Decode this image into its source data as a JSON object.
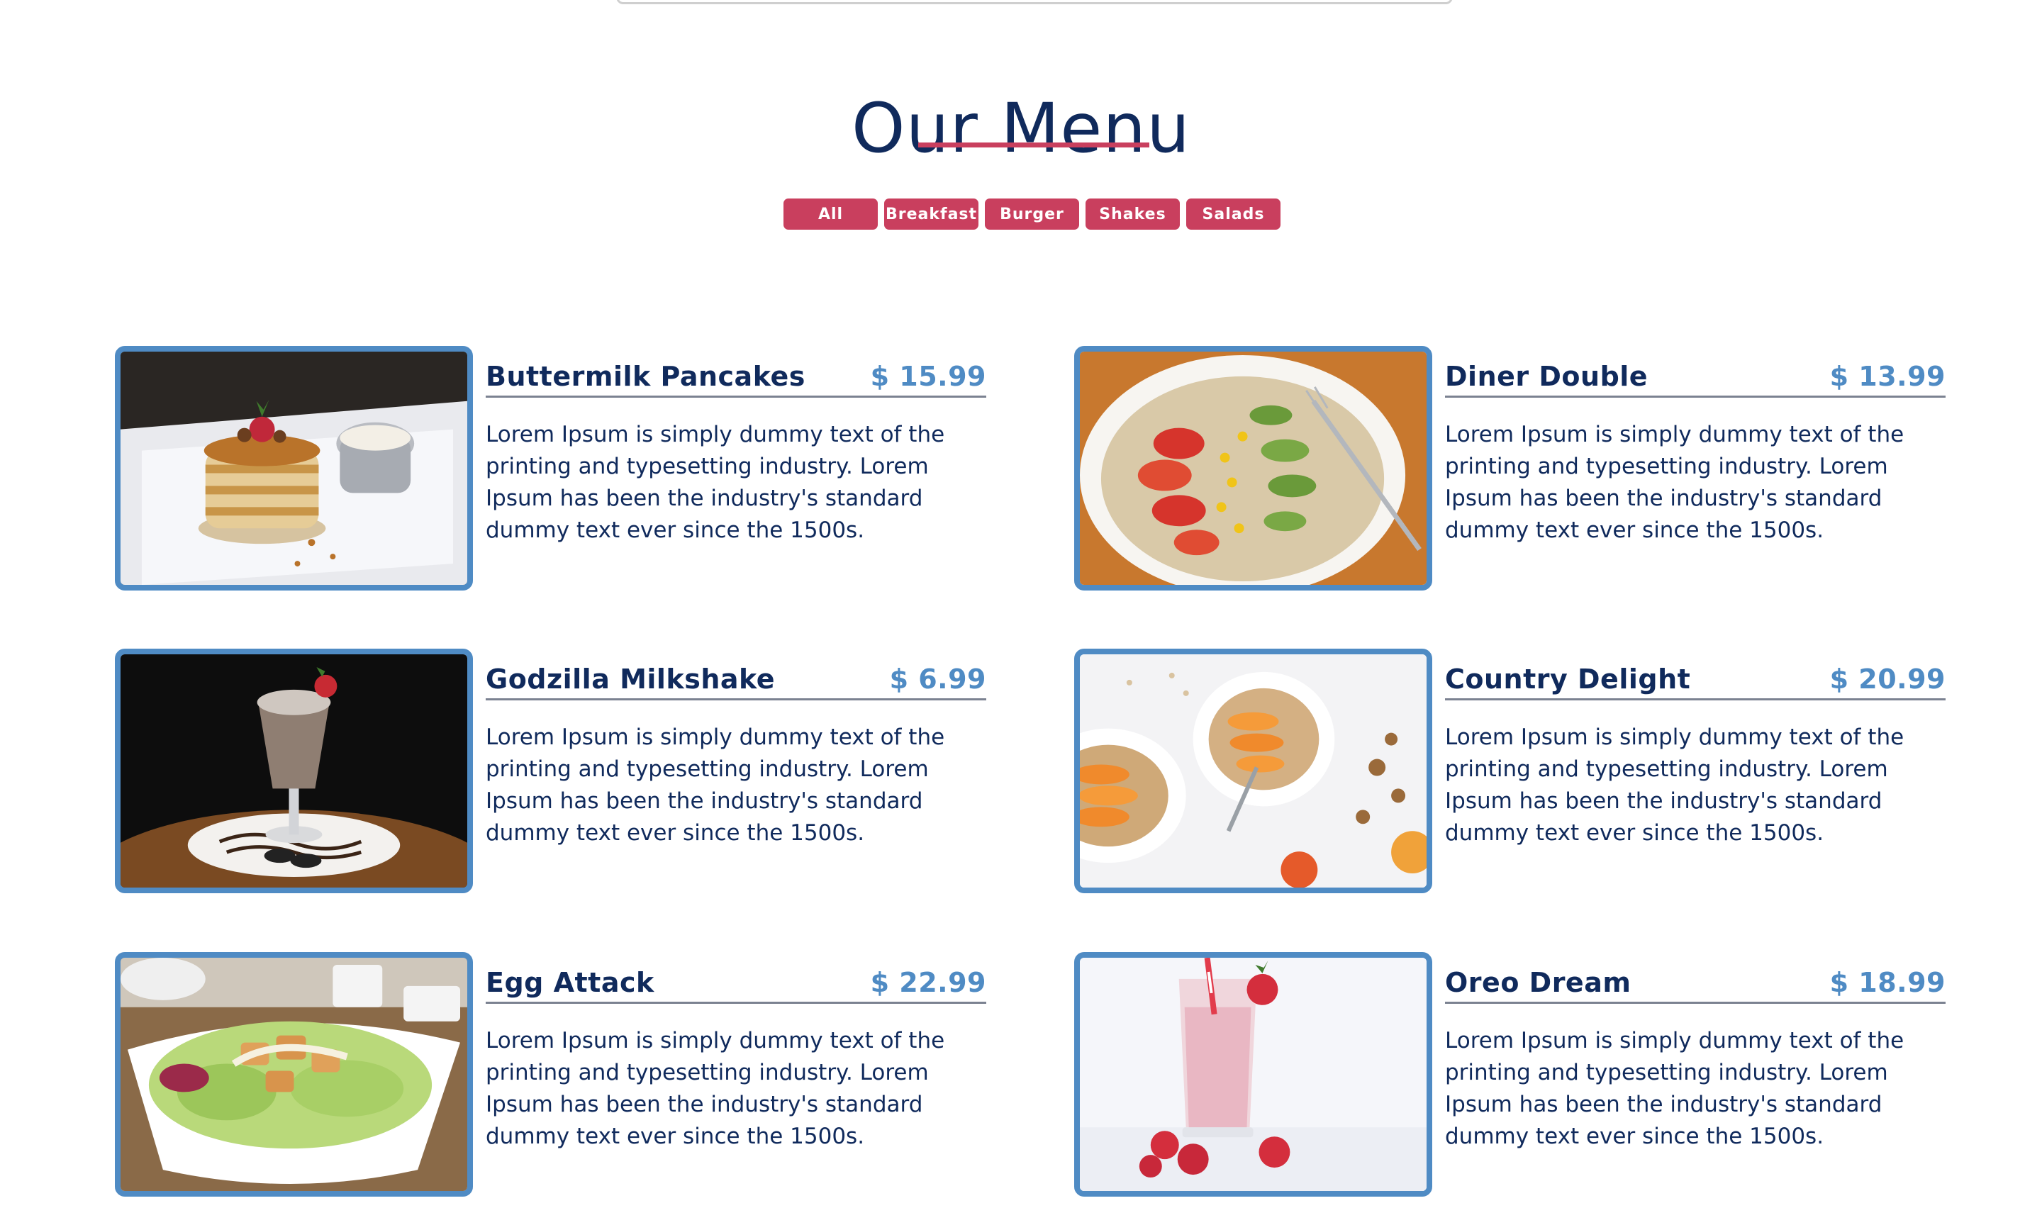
{
  "page": {
    "title": "Our Menu"
  },
  "colors": {
    "navy": "#102a5c",
    "accent": "#c93f5e",
    "price_blue": "#4f8bc4"
  },
  "filters": [
    {
      "label": "All"
    },
    {
      "label": "Breakfast"
    },
    {
      "label": "Burger"
    },
    {
      "label": "Shakes"
    },
    {
      "label": "Salads"
    }
  ],
  "items": [
    {
      "name": "Buttermilk Pancakes",
      "price": "$ 15.99",
      "description": "Lorem Ipsum is simply dummy text of the printing and typesetting industry. Lorem Ipsum has been the industry's standard dummy text ever since the 1500s.",
      "image": "pancakes-photo"
    },
    {
      "name": "Diner Double",
      "price": "$ 13.99",
      "description": "Lorem Ipsum is simply dummy text of the printing and typesetting industry. Lorem Ipsum has been the industry's standard dummy text ever since the 1500s.",
      "image": "avocado-tomato-plate-photo"
    },
    {
      "name": "Godzilla Milkshake",
      "price": "$ 6.99",
      "description": "Lorem Ipsum is simply dummy text of the printing and typesetting industry. Lorem Ipsum has been the industry's standard dummy text ever since the 1500s.",
      "image": "chocolate-milkshake-photo"
    },
    {
      "name": "Country Delight",
      "price": "$ 20.99",
      "description": "Lorem Ipsum is simply dummy text of the printing and typesetting industry. Lorem Ipsum has been the industry's standard dummy text ever since the 1500s.",
      "image": "granola-bowls-photo"
    },
    {
      "name": "Egg Attack",
      "price": "$ 22.99",
      "description": "Lorem Ipsum is simply dummy text of the printing and typesetting industry. Lorem Ipsum has been the industry's standard dummy text ever since the 1500s.",
      "image": "salad-bowl-photo"
    },
    {
      "name": "Oreo Dream",
      "price": "$ 18.99",
      "description": "Lorem Ipsum is simply dummy text of the printing and typesetting industry. Lorem Ipsum has been the industry's standard dummy text ever since the 1500s.",
      "image": "strawberry-shake-photo"
    }
  ]
}
